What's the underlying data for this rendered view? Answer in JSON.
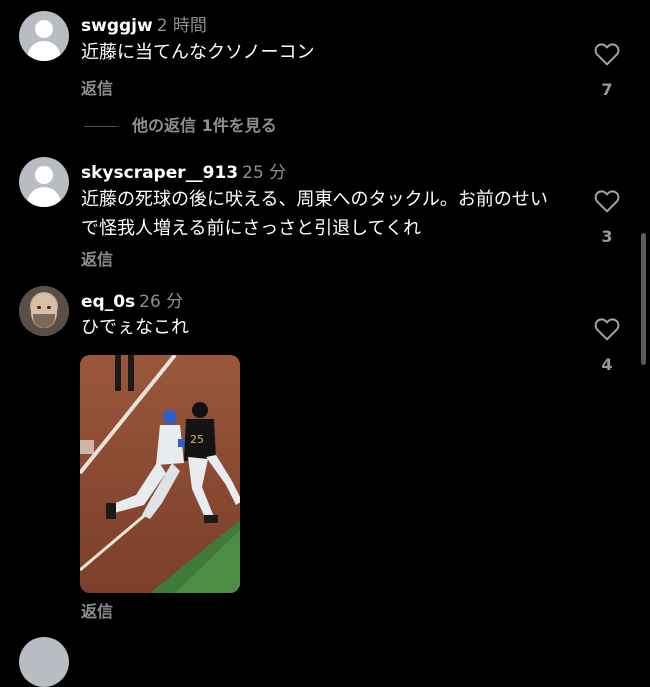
{
  "comments": [
    {
      "username": "swggjw",
      "time": "2 時間",
      "text": "近藤に当てんなクソノーコン",
      "reply_label": "返信",
      "likes": "7"
    },
    {
      "username": "skyscraper__913",
      "time": "25 分",
      "text": "近藤の死球の後に吠える、周東へのタックル。お前のせいで怪我人増える前にさっさと引退してくれ",
      "reply_label": "返信",
      "likes": "3"
    },
    {
      "username": "eq_0s",
      "time": "26 分",
      "text": "ひでぇなこれ",
      "reply_label": "返信",
      "likes": "4"
    }
  ],
  "view_replies": "他の返信 1件を見る",
  "colors": {
    "background": "#000000",
    "text": "#ffffff",
    "muted": "#8e8e93"
  },
  "icons": {
    "like": "heart-outline-icon",
    "default_avatar": "person-icon"
  }
}
